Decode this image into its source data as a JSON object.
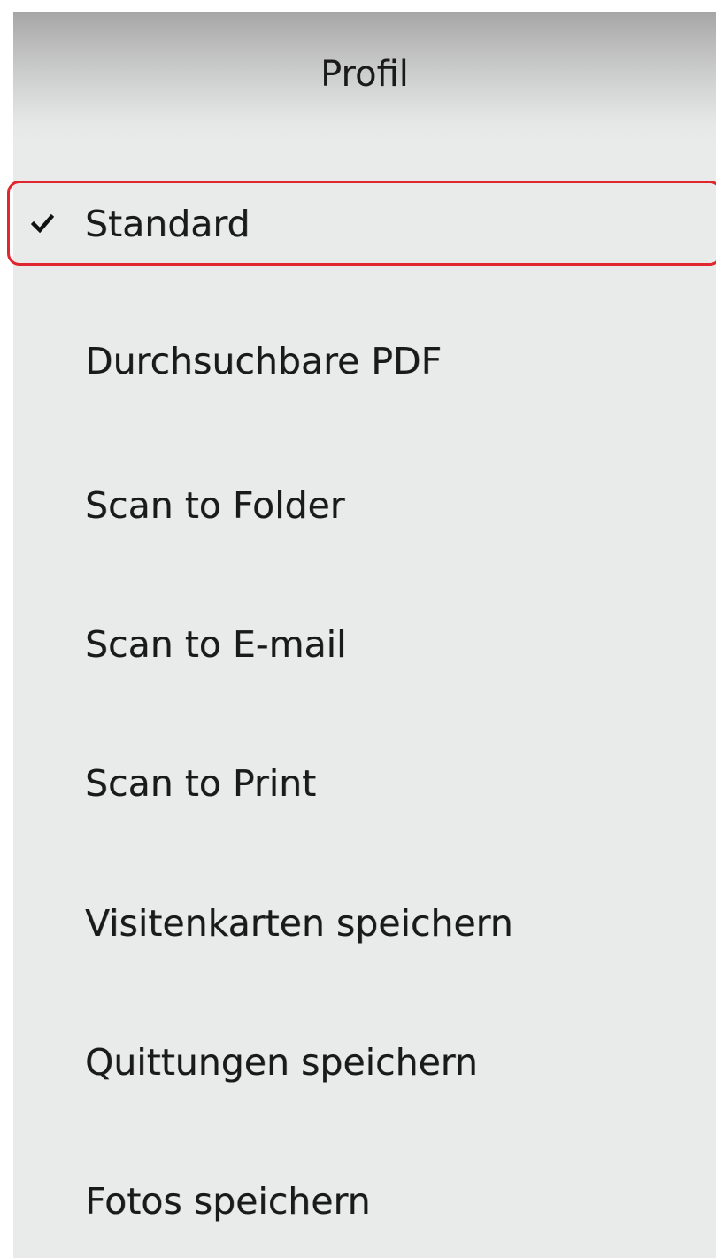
{
  "menu": {
    "header": "Profil",
    "items": [
      {
        "label": "Standard",
        "checked": true
      },
      {
        "label": "Durchsuchbare PDF",
        "checked": false
      },
      {
        "label": "Scan to Folder",
        "checked": false
      },
      {
        "label": "Scan to E-mail",
        "checked": false
      },
      {
        "label": "Scan to Print",
        "checked": false
      },
      {
        "label": "Visitenkarten speichern",
        "checked": false
      },
      {
        "label": "Quittungen speichern",
        "checked": false
      },
      {
        "label": "Fotos speichern",
        "checked": false
      }
    ]
  },
  "icons": {
    "check": "checkmark-icon"
  },
  "colors": {
    "highlight": "#e0262f",
    "panel_background": "#e9eaea",
    "text": "#1a1a1a"
  }
}
